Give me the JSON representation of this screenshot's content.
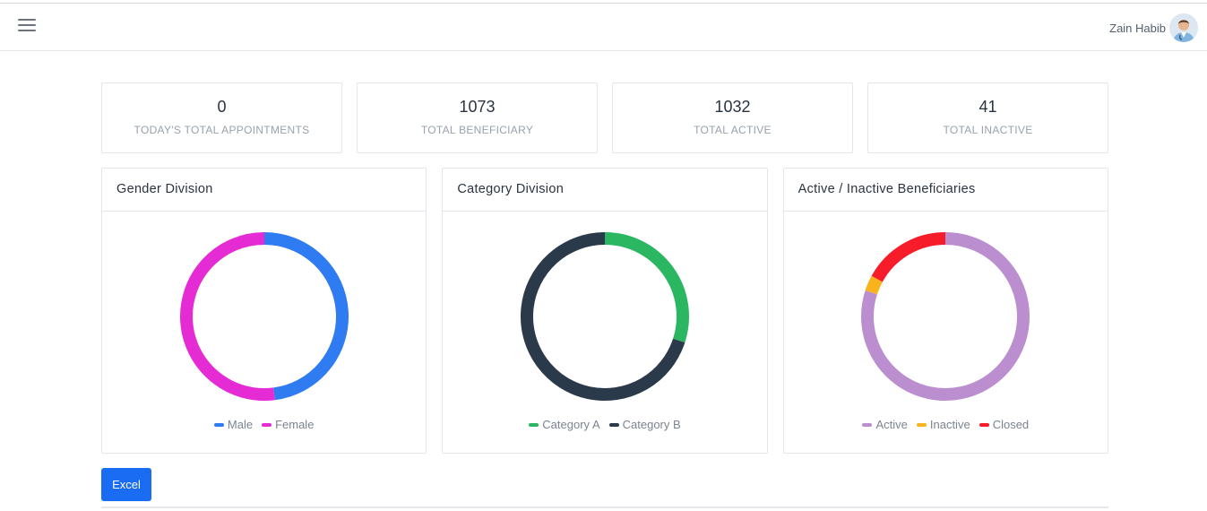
{
  "user": {
    "name": "Zain Habib"
  },
  "stats": [
    {
      "value": "0",
      "label": "TODAY'S TOTAL APPOINTMENTS"
    },
    {
      "value": "1073",
      "label": "TOTAL BENEFICIARY"
    },
    {
      "value": "1032",
      "label": "TOTAL ACTIVE"
    },
    {
      "value": "41",
      "label": "TOTAL INACTIVE"
    }
  ],
  "cards": [
    {
      "title": "Gender Division"
    },
    {
      "title": "Category Division"
    },
    {
      "title": "Active / Inactive Beneficiaries"
    }
  ],
  "chart_data": [
    {
      "type": "pie",
      "title": "Gender Division",
      "labels": [
        "Male",
        "Female"
      ],
      "values": [
        48,
        52
      ],
      "colors": [
        "#2f7bf1",
        "#e52bd3"
      ],
      "legend": "bottom"
    },
    {
      "type": "pie",
      "title": "Category Division",
      "labels": [
        "Category A",
        "Category B"
      ],
      "values": [
        30,
        70
      ],
      "colors": [
        "#2bb761",
        "#2b3a4b"
      ],
      "legend": "bottom"
    },
    {
      "type": "pie",
      "title": "Active / Inactive Beneficiaries",
      "labels": [
        "Active",
        "Inactive",
        "Closed"
      ],
      "values": [
        80,
        3,
        17
      ],
      "colors": [
        "#bb8ecf",
        "#f9b31c",
        "#f71c2a"
      ],
      "legend": "bottom"
    }
  ],
  "actions": {
    "excel_label": "Excel"
  },
  "icons": {
    "menu": "hamburger-menu-icon",
    "avatar": "user-avatar"
  }
}
